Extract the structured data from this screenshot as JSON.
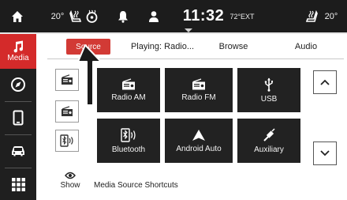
{
  "status": {
    "left_temp": "20°",
    "clock": "11:32",
    "ext_temp": "72°EXT",
    "right_temp": "20°"
  },
  "sidebar": {
    "media_label": "Media"
  },
  "tabs": {
    "source": "Source",
    "playing": "Playing: Radio...",
    "browse": "Browse",
    "audio": "Audio"
  },
  "tiles": {
    "radio_am": "Radio AM",
    "radio_fm": "Radio FM",
    "usb": "USB",
    "bluetooth": "Bluetooth",
    "android_auto": "Android Auto",
    "auxiliary": "Auxiliary"
  },
  "bottom": {
    "show_label": "Show",
    "shortcuts_label": "Media Source Shortcuts"
  },
  "colors": {
    "accent_red": "#d42a2a",
    "tile_bg": "#222222",
    "bar_bg": "#1c1c1c"
  }
}
